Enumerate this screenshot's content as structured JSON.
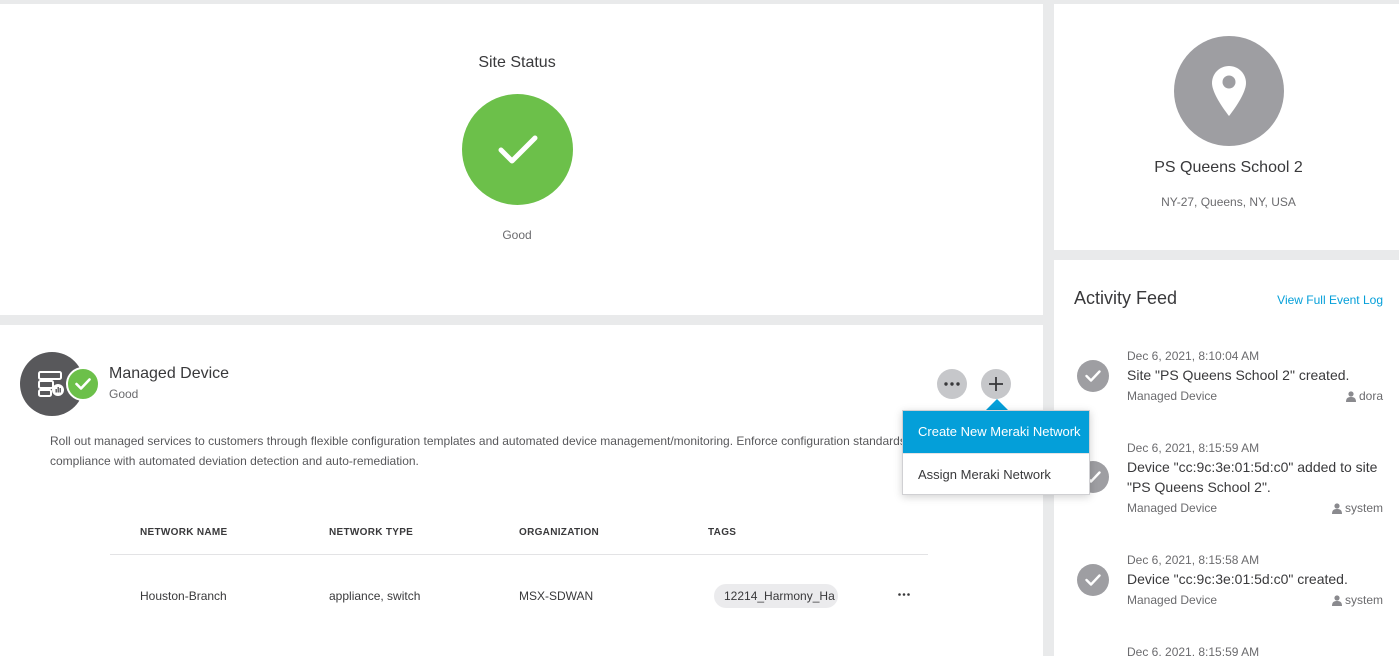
{
  "site_status": {
    "title": "Site Status",
    "state": "Good",
    "icon": "check-icon",
    "color": "#6cc04a"
  },
  "site_profile": {
    "icon": "map-pin-icon",
    "name": "PS Queens School 2",
    "address": "NY-27, Queens, NY, USA"
  },
  "activity_feed": {
    "title": "Activity Feed",
    "link": "View Full Event Log",
    "items": [
      {
        "time": "Dec 6, 2021, 8:10:04 AM",
        "message": "Site \"PS Queens School 2\" created.",
        "source": "Managed Device",
        "user": "dora"
      },
      {
        "time": "Dec 6, 2021, 8:15:59 AM",
        "message": "Device \"cc:9c:3e:01:5d:c0\" added to site \"PS Queens School 2\".",
        "source": "Managed Device",
        "user": "system"
      },
      {
        "time": "Dec 6, 2021, 8:15:58 AM",
        "message": "Device \"cc:9c:3e:01:5d:c0\" created.",
        "source": "Managed Device",
        "user": "system"
      },
      {
        "time": "Dec 6, 2021, 8:15:59 AM"
      }
    ]
  },
  "managed_device": {
    "title": "Managed Device",
    "status": "Good",
    "description": "Roll out managed services to customers through flexible configuration templates and automated device management/monitoring. Enforce configuration standards and device compliance with automated deviation detection and auto-remediation.",
    "more_icon": "more-horizontal-icon",
    "add_icon": "plus-icon",
    "dropdown": {
      "items": [
        "Create New Meraki Network",
        "Assign Meraki Network"
      ],
      "highlight_color": "#049fd9"
    },
    "table": {
      "columns": [
        "NETWORK NAME",
        "NETWORK TYPE",
        "ORGANIZATION",
        "TAGS"
      ],
      "rows": [
        {
          "network_name": "Houston-Branch",
          "network_type": "appliance, switch",
          "organization": "MSX-SDWAN",
          "tags": "12214_Harmony_Ha"
        }
      ]
    }
  }
}
